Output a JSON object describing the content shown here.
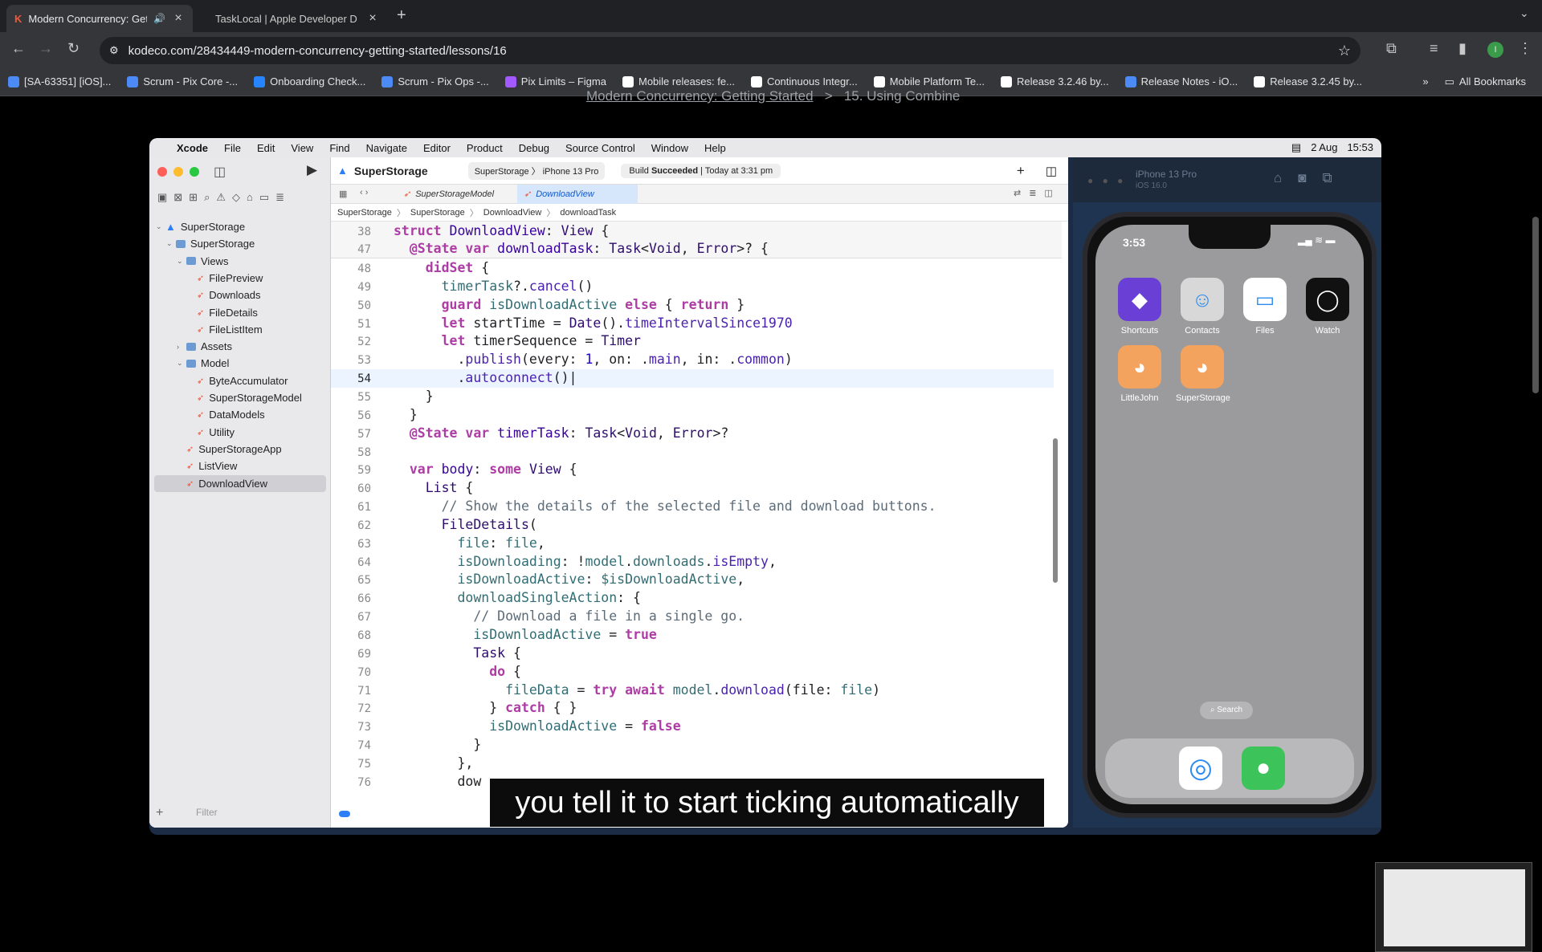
{
  "browser": {
    "tabs": [
      {
        "title": "Modern Concurrency: Get",
        "active": true
      },
      {
        "title": "TaskLocal | Apple Developer D",
        "active": false
      }
    ],
    "url": "kodeco.com/28434449-modern-concurrency-getting-started/lessons/16",
    "bookmarks": [
      "[SA-63351] [iOS]...",
      "Scrum - Pix Core -...",
      "Onboarding Check...",
      "Scrum - Pix Ops -...",
      "Pix Limits – Figma",
      "Mobile releases: fe...",
      "Continuous Integr...",
      "Mobile Platform Te...",
      "Release 3.2.46 by...",
      "Release Notes - iO...",
      "Release 3.2.45 by..."
    ],
    "bookmark_colors": [
      "#4c8bf5",
      "#4c8bf5",
      "#2684ff",
      "#4c8bf5",
      "#a259ff",
      "#ffffff",
      "#ffffff",
      "#ffffff",
      "#ffffff",
      "#4c8bf5",
      "#ffffff"
    ],
    "all_bookmarks": "All Bookmarks",
    "page_breadcrumb": "Modern Concurrency: Getting Started",
    "page_breadcrumb_sep": ">",
    "page_breadcrumb_current": "15. Using Combine"
  },
  "mac": {
    "menu": [
      "Xcode",
      "File",
      "Edit",
      "View",
      "Find",
      "Navigate",
      "Editor",
      "Product",
      "Debug",
      "Source Control",
      "Window",
      "Help"
    ],
    "date": "2 Aug",
    "time": "15:53"
  },
  "xcode": {
    "project": "SuperStorage",
    "scheme": "SuperStorage",
    "device": "iPhone 13 Pro",
    "build_status_prefix": "Build",
    "build_status": "Succeeded",
    "build_time": "| Today at 3:31 pm",
    "tabs": [
      "SuperStorageModel",
      "DownloadView"
    ],
    "jumpbar": [
      "SuperStorage",
      "SuperStorage",
      "DownloadView",
      "downloadTask"
    ],
    "filter_placeholder": "Filter",
    "tree": [
      {
        "label": "SuperStorage",
        "depth": 0,
        "kind": "project"
      },
      {
        "label": "SuperStorage",
        "depth": 1,
        "kind": "folder"
      },
      {
        "label": "Views",
        "depth": 2,
        "kind": "folder"
      },
      {
        "label": "FilePreview",
        "depth": 3,
        "kind": "swift"
      },
      {
        "label": "Downloads",
        "depth": 3,
        "kind": "swift"
      },
      {
        "label": "FileDetails",
        "depth": 3,
        "kind": "swift"
      },
      {
        "label": "FileListItem",
        "depth": 3,
        "kind": "swift"
      },
      {
        "label": "Assets",
        "depth": 2,
        "kind": "folder"
      },
      {
        "label": "Model",
        "depth": 2,
        "kind": "folder"
      },
      {
        "label": "ByteAccumulator",
        "depth": 3,
        "kind": "swift"
      },
      {
        "label": "SuperStorageModel",
        "depth": 3,
        "kind": "swift"
      },
      {
        "label": "DataModels",
        "depth": 3,
        "kind": "swift"
      },
      {
        "label": "Utility",
        "depth": 3,
        "kind": "swift"
      },
      {
        "label": "SuperStorageApp",
        "depth": 2,
        "kind": "swift"
      },
      {
        "label": "ListView",
        "depth": 2,
        "kind": "swift"
      },
      {
        "label": "DownloadView",
        "depth": 2,
        "kind": "swift",
        "selected": true
      }
    ],
    "sticky": [
      {
        "n": "38",
        "html": "<span class='k'>struct</span> <span class='t'>DownloadView</span>: <span class='p'>View</span> {"
      },
      {
        "n": "47",
        "html": "  <span class='k'>@State</span> <span class='k'>var</span> <span class='t'>downloadTask</span>: <span class='p'>Task</span>&lt;<span class='p'>Void</span>, <span class='p'>Error</span>&gt;? {"
      }
    ],
    "code": [
      {
        "n": "48",
        "html": "    <span class='k'>didSet</span> {"
      },
      {
        "n": "49",
        "html": "      <span class='v'>timerTask</span>?.<span class='f'>cancel</span>()"
      },
      {
        "n": "50",
        "html": "      <span class='k'>guard</span> <span class='v'>isDownloadActive</span> <span class='k'>else</span> { <span class='k'>return</span> }"
      },
      {
        "n": "51",
        "html": "      <span class='k'>let</span> startTime = <span class='p'>Date</span>().<span class='f'>timeIntervalSince1970</span>"
      },
      {
        "n": "52",
        "html": "      <span class='k'>let</span> timerSequence = <span class='p'>Timer</span>"
      },
      {
        "n": "53",
        "html": "        .<span class='f'>publish</span>(every: <span class='n'>1</span>, on: .<span class='f'>main</span>, in: .<span class='f'>common</span>)"
      },
      {
        "n": "54",
        "html": "        .<span class='f'>autoconnect</span>()|",
        "current": true
      },
      {
        "n": "55",
        "html": "    }"
      },
      {
        "n": "56",
        "html": "  }"
      },
      {
        "n": "57",
        "html": "  <span class='k'>@State</span> <span class='k'>var</span> <span class='t'>timerTask</span>: <span class='p'>Task</span>&lt;<span class='p'>Void</span>, <span class='p'>Error</span>&gt;?"
      },
      {
        "n": "58",
        "html": ""
      },
      {
        "n": "59",
        "html": "  <span class='k'>var</span> <span class='t'>body</span>: <span class='k'>some</span> <span class='p'>View</span> {"
      },
      {
        "n": "60",
        "html": "    <span class='p'>List</span> {"
      },
      {
        "n": "61",
        "html": "      <span class='c'>// Show the details of the selected file and download buttons.</span>"
      },
      {
        "n": "62",
        "html": "      <span class='p'>FileDetails</span>("
      },
      {
        "n": "63",
        "html": "        <span class='v'>file</span>: <span class='v'>file</span>,"
      },
      {
        "n": "64",
        "html": "        <span class='v'>isDownloading</span>: !<span class='v'>model</span>.<span class='v'>downloads</span>.<span class='f'>isEmpty</span>,"
      },
      {
        "n": "65",
        "html": "        <span class='v'>isDownloadActive</span>: <span class='v'>$isDownloadActive</span>,"
      },
      {
        "n": "66",
        "html": "        <span class='v'>downloadSingleAction</span>: {"
      },
      {
        "n": "67",
        "html": "          <span class='c'>// Download a file in a single go.</span>"
      },
      {
        "n": "68",
        "html": "          <span class='v'>isDownloadActive</span> = <span class='k'>true</span>"
      },
      {
        "n": "69",
        "html": "          <span class='p'>Task</span> {"
      },
      {
        "n": "70",
        "html": "            <span class='k'>do</span> {"
      },
      {
        "n": "71",
        "html": "              <span class='v'>fileData</span> = <span class='k'>try</span> <span class='k'>await</span> <span class='v'>model</span>.<span class='f'>download</span>(file: <span class='v'>file</span>)"
      },
      {
        "n": "72",
        "html": "            } <span class='k'>catch</span> { }"
      },
      {
        "n": "73",
        "html": "            <span class='v'>isDownloadActive</span> = <span class='k'>false</span>"
      },
      {
        "n": "74",
        "html": "          }"
      },
      {
        "n": "75",
        "html": "        },"
      },
      {
        "n": "76",
        "html": "        dow"
      }
    ]
  },
  "simulator": {
    "title": "iPhone 13 Pro",
    "os": "iOS 16.0",
    "time": "3:53",
    "apps": [
      {
        "label": "Shortcuts",
        "glyph": "◆",
        "color": "#6a3fd6"
      },
      {
        "label": "Contacts",
        "glyph": "☺",
        "color": "#d8d8d8"
      },
      {
        "label": "Files",
        "glyph": "▭",
        "color": "#ffffff"
      },
      {
        "label": "Watch",
        "glyph": "◯",
        "color": "#111111"
      },
      {
        "label": "LittleJohn",
        "glyph": "◕",
        "color": "#f3a35d"
      },
      {
        "label": "SuperStorage",
        "glyph": "◕",
        "color": "#f3a35d"
      }
    ],
    "search": "Search",
    "dock": [
      {
        "glyph": "◎",
        "color": "#2d8cf0"
      },
      {
        "glyph": "●",
        "color": "#3cc45b"
      }
    ]
  },
  "caption": "you tell it to start ticking automatically"
}
